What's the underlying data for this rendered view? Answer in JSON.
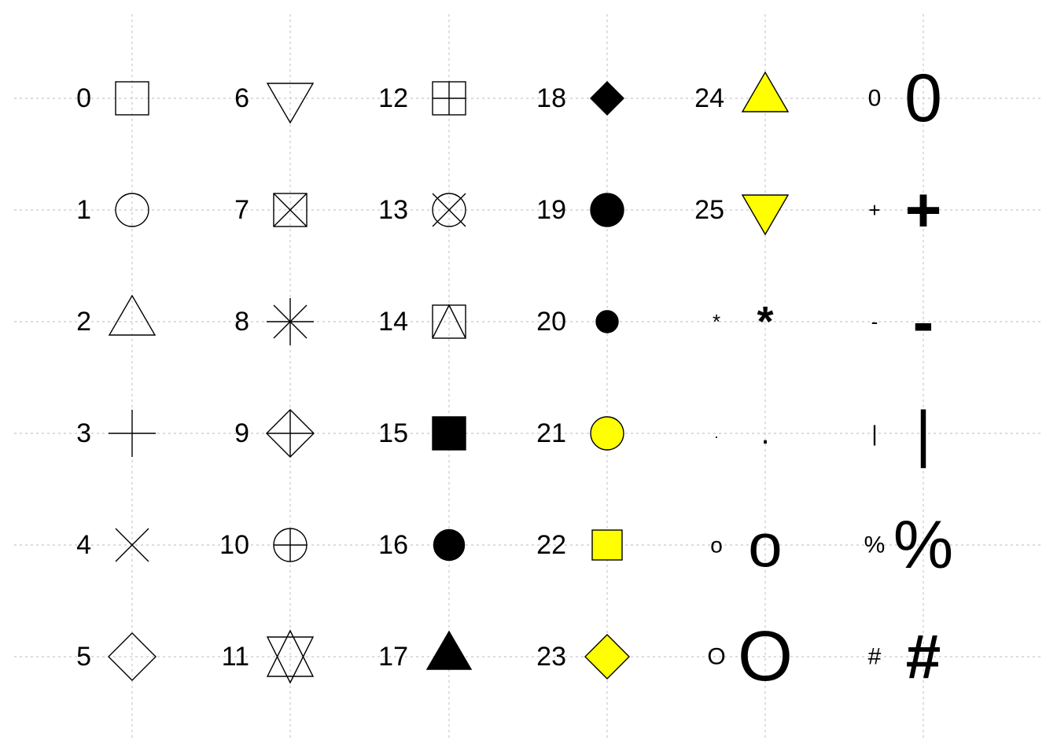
{
  "chart_data": {
    "type": "scatter",
    "title": "",
    "xlabel": "",
    "ylabel": "",
    "grid": true,
    "axes_visible": false,
    "columns": [
      [
        "0",
        "1",
        "2",
        "3",
        "4",
        "5"
      ],
      [
        "6",
        "7",
        "8",
        "9",
        "10",
        "11"
      ],
      [
        "12",
        "13",
        "14",
        "15",
        "16",
        "17"
      ],
      [
        "18",
        "19",
        "20",
        "21",
        "22",
        "23"
      ],
      [
        "24",
        "25",
        "*",
        ".",
        "o",
        "O"
      ],
      [
        "0",
        "+",
        "-",
        "|",
        "%",
        "#"
      ]
    ],
    "colors": {
      "stroke": "#000000",
      "fill": "#000000",
      "highlight_fill": "#FFFF00",
      "grid": "#c8c8c8"
    }
  }
}
